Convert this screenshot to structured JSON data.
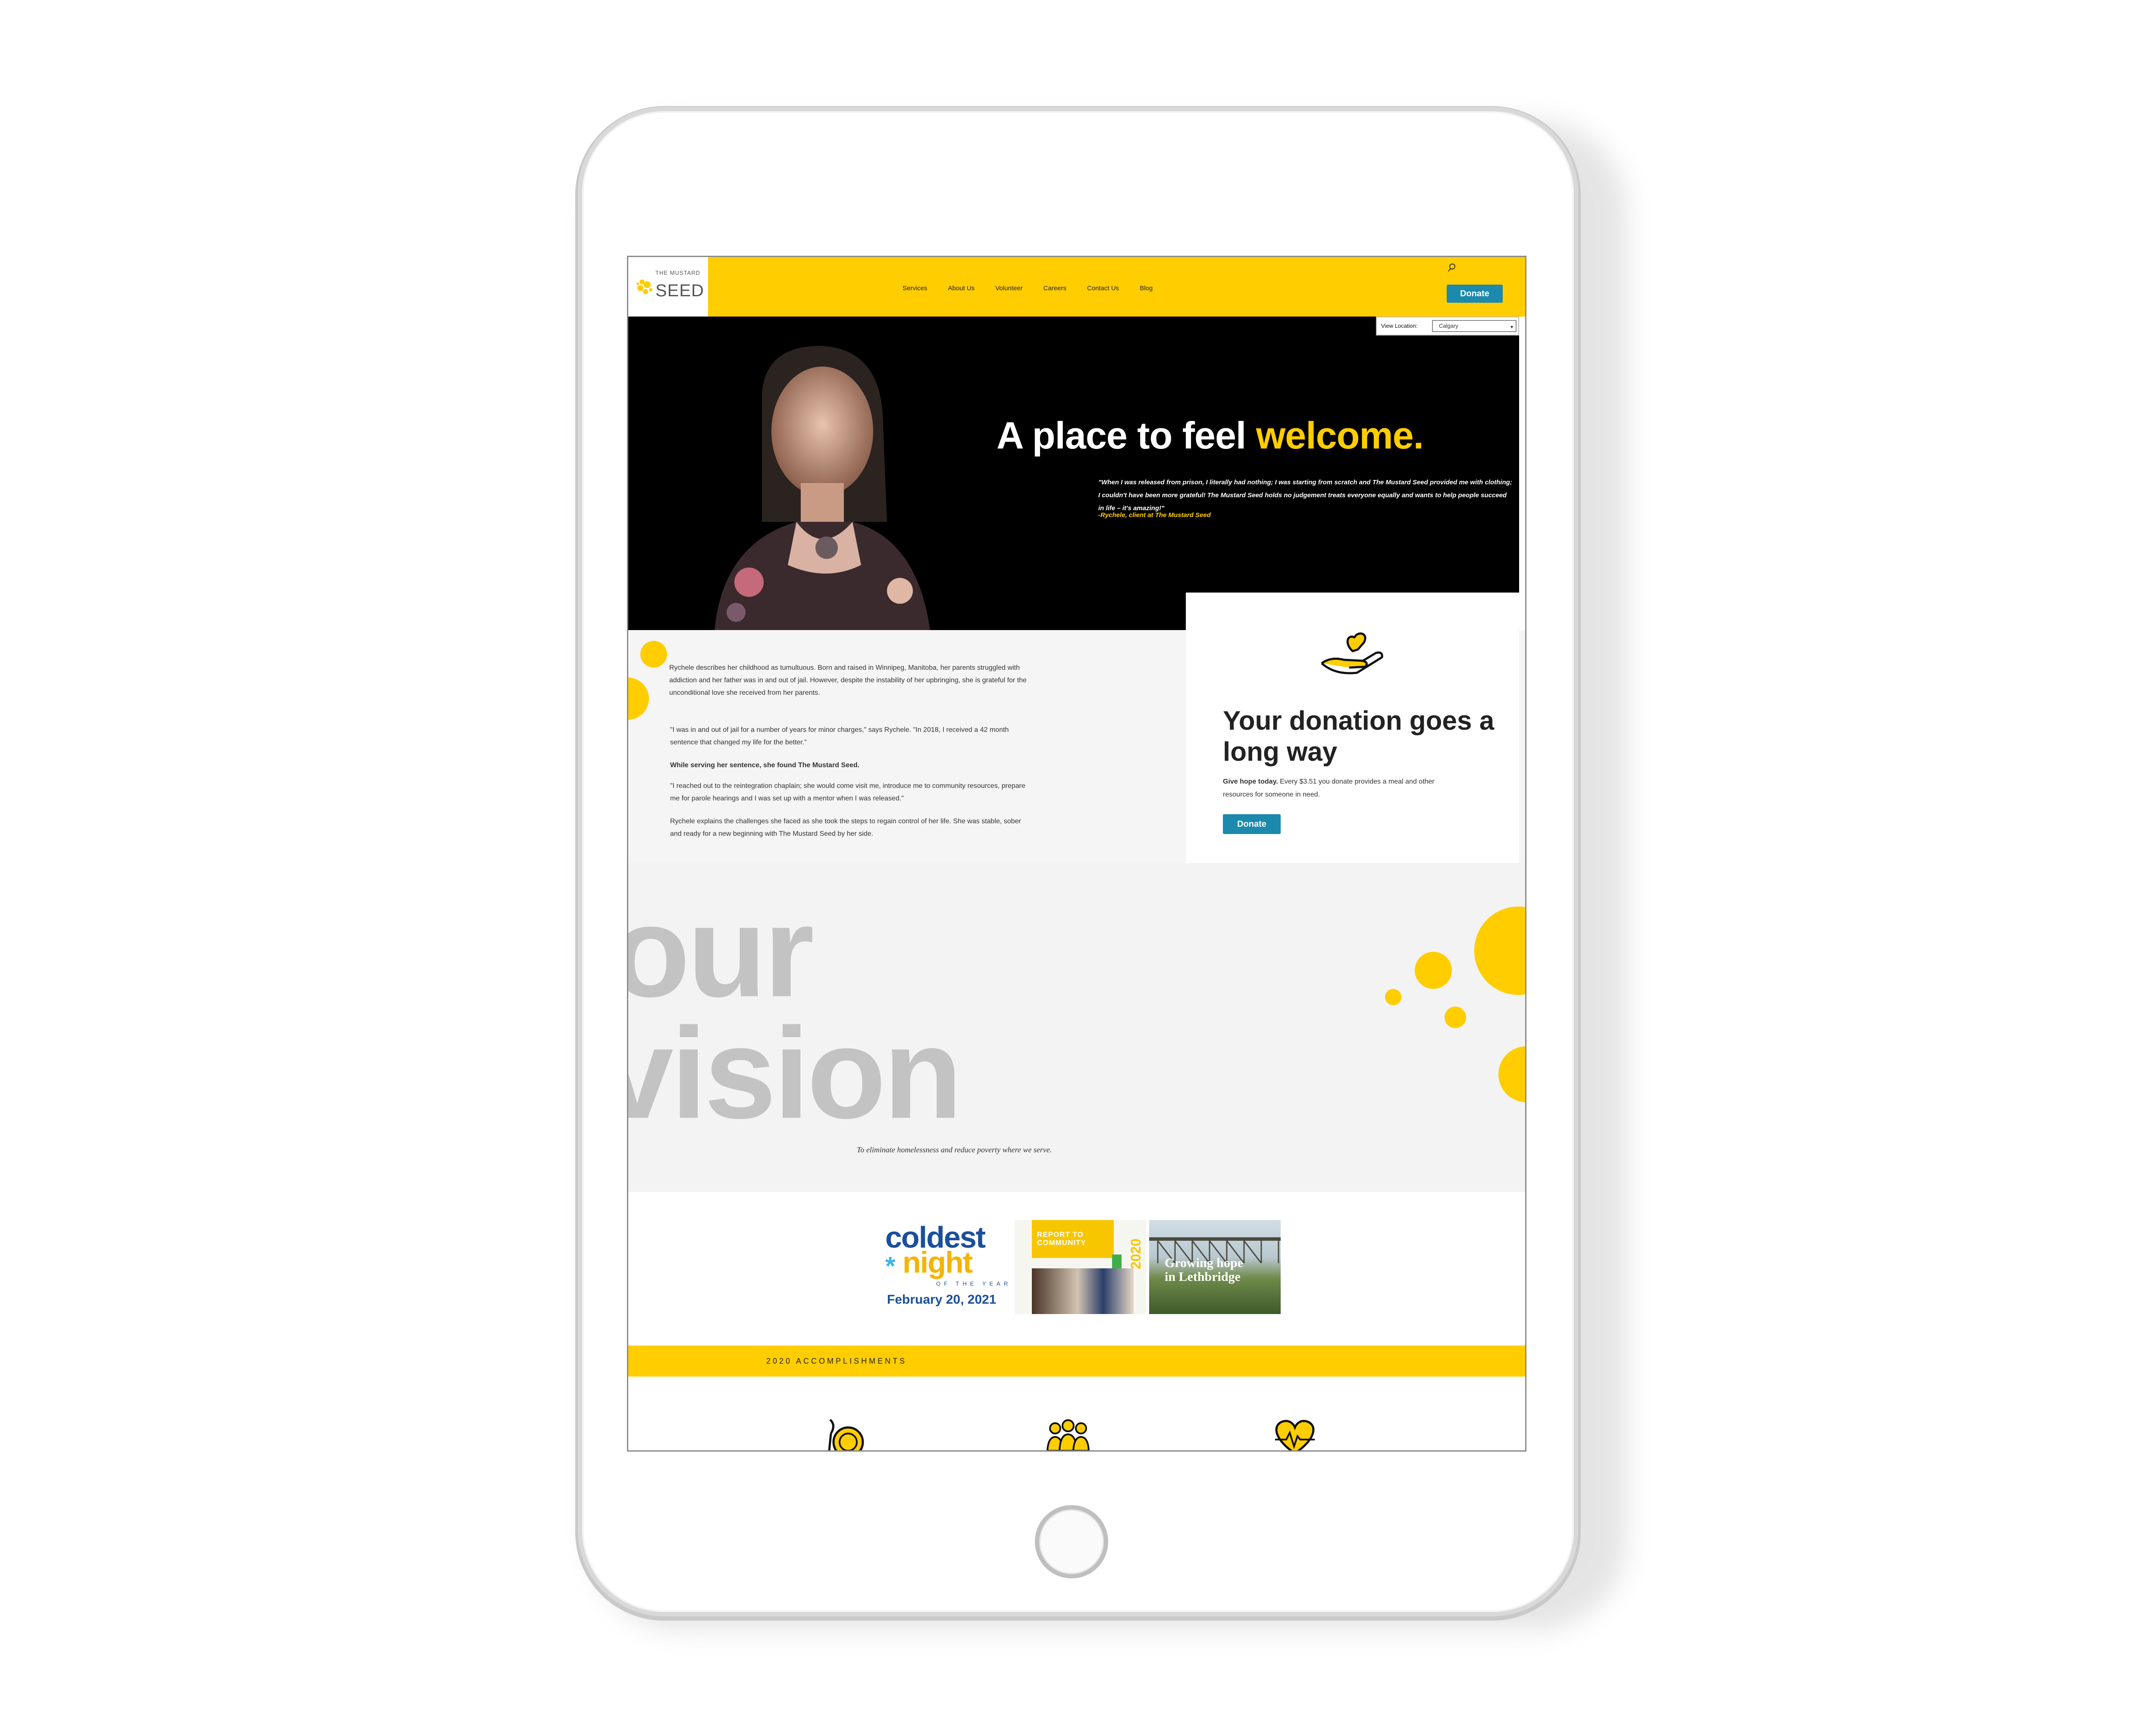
{
  "header": {
    "logo_small": "THE MUSTARD",
    "logo_big": "SEED",
    "nav": [
      "Services",
      "About Us",
      "Volunteer",
      "Careers",
      "Contact Us",
      "Blog"
    ],
    "donate_label": "Donate",
    "search_icon": "search-icon"
  },
  "location": {
    "label": "View Location:",
    "selected": "Calgary"
  },
  "hero": {
    "title_prefix": "A place to feel ",
    "title_accent": "welcome.",
    "quote": "\"When I was released from prison, I literally had nothing; I was starting from scratch and The Mustard Seed provided me with clothing; I couldn't have been more grateful! The Mustard Seed holds no judgement treats everyone equally and wants to help people succeed in life – it's amazing!\"",
    "attribution": "-Rychele, client at The Mustard Seed"
  },
  "story": {
    "paragraphs": [
      "Rychele describes her childhood as tumultuous. Born and raised in Winnipeg, Manitoba, her parents struggled with addiction and her father was in and out of jail. However, despite the instability of her upbringing, she is grateful for the unconditional love she received from her parents.",
      "\"I was in and out of jail for a number of years for minor charges,\" says Rychele. \"In 2018, I received a 42 month sentence that changed my life for the better.\"",
      "While serving her sentence, she found The Mustard Seed.",
      "\"I reached out to the reintegration chaplain; she would come visit me, introduce me to community resources, prepare me for parole hearings and I was set up with a mentor when I was released.\"",
      "Rychele explains the challenges she faced as she took the steps to regain control of her life. She was stable, sober and ready for a new beginning with The Mustard Seed by her side."
    ]
  },
  "donation": {
    "title": "Your donation goes a long way",
    "lead": "Give hope today.",
    "text": " Every $3.51 you donate provides a meal and other resources for someone in need.",
    "button": "Donate",
    "icon": "heart-in-hand-icon"
  },
  "vision": {
    "word1": "our",
    "word2": "vision",
    "statement": "To eliminate homelessness and reduce poverty where we serve."
  },
  "promos": {
    "coldest": {
      "line1": "coldest",
      "line2": "night",
      "star": "*",
      "sub": "OF THE YEAR",
      "date": "February 20, 2021"
    },
    "report": {
      "title_line1": "REPORT TO",
      "title_line2": "COMMUNITY",
      "year": "2020"
    },
    "lethbridge": {
      "line1": "Growing hope",
      "line2": "in Lethbridge"
    }
  },
  "accomplishments": {
    "label": "2020 ACCOMPLISHMENTS",
    "icons": [
      "meal-icon",
      "people-icon",
      "heart-health-icon"
    ]
  },
  "colors": {
    "brand_yellow": "#ffcd00",
    "button_blue": "#1b8aac",
    "vision_gray": "#c3c3c3"
  }
}
